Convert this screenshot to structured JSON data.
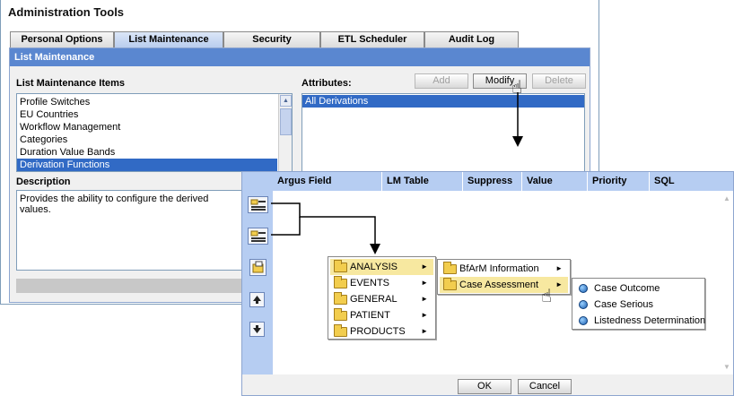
{
  "app": {
    "title": "Administration Tools"
  },
  "tabs": [
    {
      "label": "Personal Options",
      "active": false
    },
    {
      "label": "List Maintenance",
      "active": true
    },
    {
      "label": "Security",
      "active": false
    },
    {
      "label": "ETL Scheduler",
      "active": false
    },
    {
      "label": "Audit Log",
      "active": false
    }
  ],
  "panel": {
    "title": "List Maintenance",
    "items_label": "List Maintenance Items",
    "items": [
      "Profile Switches",
      "EU Countries",
      "Workflow Management",
      "Categories",
      "Duration Value Bands",
      "Derivation Functions"
    ],
    "selected_item": "Derivation Functions",
    "attributes_label": "Attributes:",
    "attributes": [
      "All Derivations"
    ],
    "buttons": {
      "add": "Add",
      "modify": "Modify",
      "delete": "Delete"
    },
    "description_label": "Description",
    "description_text": "Provides the ability to configure the derived values."
  },
  "dialog": {
    "columns": [
      "Argus Field",
      "LM Table",
      "Suppress",
      "Value",
      "Priority",
      "SQL"
    ],
    "ok": "OK",
    "cancel": "Cancel"
  },
  "menu1": {
    "items": [
      "ANALYSIS",
      "EVENTS",
      "GENERAL",
      "PATIENT",
      "PRODUCTS"
    ],
    "highlighted": "ANALYSIS"
  },
  "menu2": {
    "items": [
      "BfArM Information",
      "Case Assessment"
    ],
    "highlighted": "Case Assessment"
  },
  "menu3": {
    "items": [
      "Case Outcome",
      "Case Serious",
      "Listedness Determination"
    ]
  },
  "colors": {
    "accent": "#5a87d0",
    "selection": "#316ac5",
    "menu_highlight": "#f7e8a0",
    "header_blue": "#b6cdf2"
  }
}
